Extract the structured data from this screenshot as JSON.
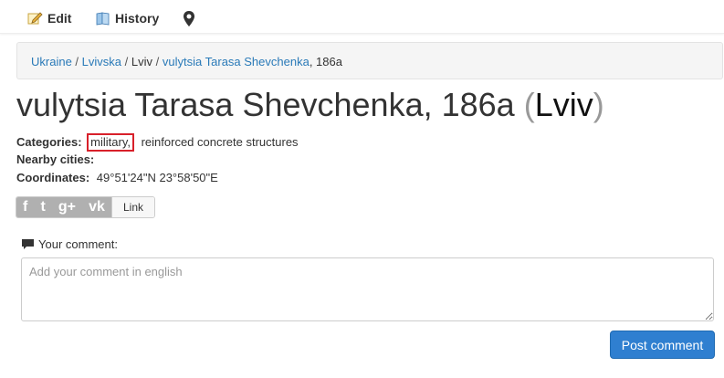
{
  "nav": {
    "edit_label": "Edit",
    "history_label": "History"
  },
  "breadcrumb": {
    "items": [
      "Ukraine",
      "Lvivska",
      "Lviv",
      "vulytsia Tarasa Shevchenka"
    ],
    "suffix": ", 186a",
    "separator": "/"
  },
  "title": {
    "main": "vulytsia Tarasa Shevchenka, 186a",
    "open_paren": "(",
    "city": "Lviv",
    "close_paren": ")"
  },
  "details": {
    "categories_label": "Categories:",
    "categories": [
      "military,",
      "reinforced concrete structures"
    ],
    "nearby_label": "Nearby cities:",
    "coordinates_label": "Coordinates:",
    "coordinates_value": "49°51'24\"N 23°58'50\"E"
  },
  "share": {
    "link_label": "Link",
    "networks": [
      "f",
      "t",
      "g+",
      "vk"
    ]
  },
  "comment": {
    "label": "Your comment:",
    "placeholder": "Add your comment in english",
    "submit_label": "Post comment"
  },
  "colors": {
    "link": "#2a7ab8",
    "highlight_border": "#d8202a",
    "button": "#2f7fd0"
  }
}
